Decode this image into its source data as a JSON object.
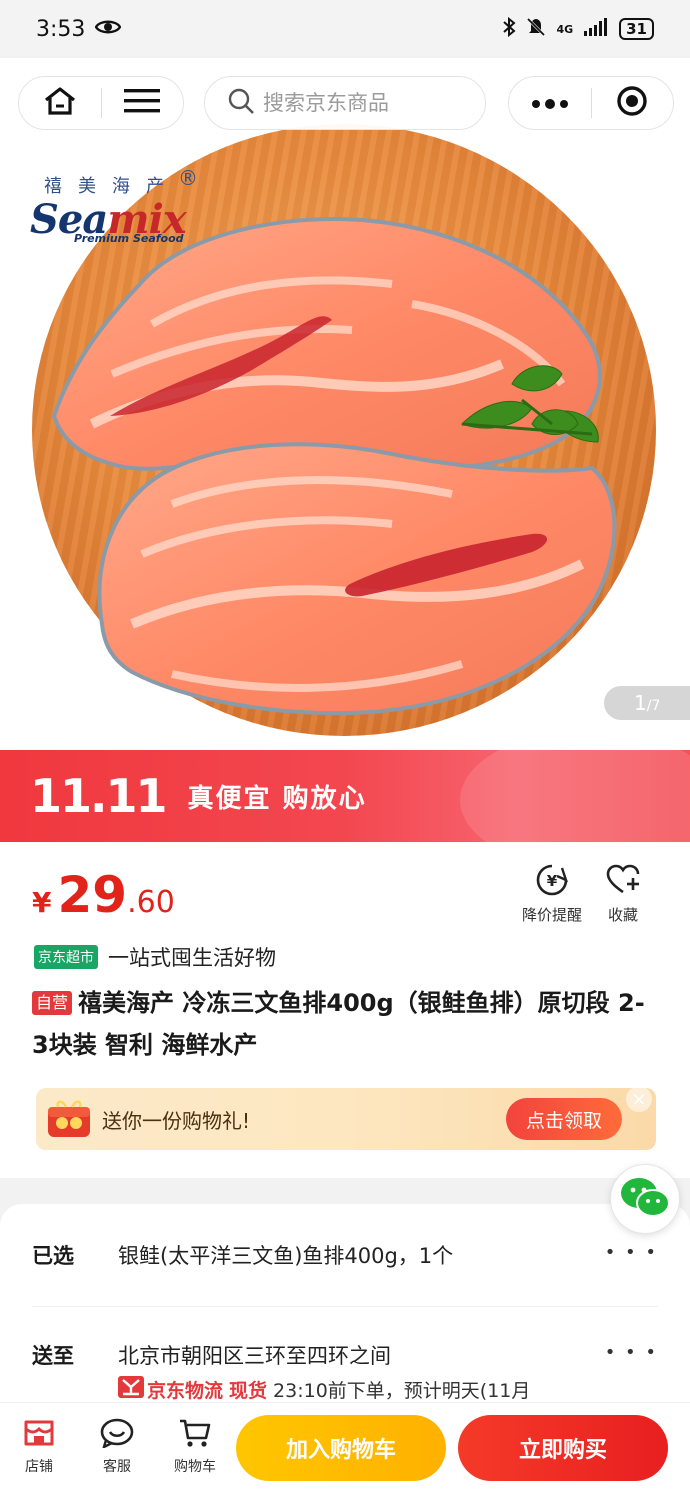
{
  "status_bar": {
    "time": "3:53",
    "network": "4G",
    "battery": "31",
    "icons": [
      "eye-icon",
      "bluetooth-icon",
      "mute-icon",
      "signal-icon",
      "battery-icon"
    ]
  },
  "nav": {
    "icons": [
      "home-icon",
      "menu-icon",
      "search-icon",
      "more-icon",
      "record-icon"
    ],
    "search_placeholder": "搜索京东商品"
  },
  "brand": {
    "cn": "禧美海产",
    "reg": "®",
    "en_a": "Sea",
    "en_b": "mix",
    "sub": "Premium Seafood"
  },
  "gallery": {
    "current": "1",
    "total": "/7"
  },
  "banner": {
    "logo": "11.11",
    "slogan": "真便宜 购放心"
  },
  "product": {
    "currency": "¥",
    "price_int": "29",
    "price_dec": ".60",
    "actions": [
      {
        "label": "降价提醒",
        "icon": "price-alert-icon"
      },
      {
        "label": "收藏",
        "icon": "favorite-icon"
      }
    ],
    "store_badge": "京东超市",
    "store_slogan": "一站式囤生活好物",
    "self_badge": "自营",
    "title": "禧美海产 冷冻三文鱼排400g（银鲑鱼排）原切段 2-3块装 智利 海鲜水产"
  },
  "gift": {
    "text": "送你一份购物礼!",
    "button": "点击领取",
    "close": "×"
  },
  "spec": {
    "selected_label": "已选",
    "selected_value": "银鲑(太平洋三文鱼)鱼排400g，1个",
    "ship_label": "送至",
    "ship_value": "北京市朝阳区三环至四环之间",
    "logistics_brand": "京东物流",
    "stock": "现货",
    "delivery": "23:10前下单，预计明天(11月"
  },
  "bottom": {
    "tabs": [
      {
        "label": "店铺",
        "icon": "store-icon"
      },
      {
        "label": "客服",
        "icon": "customer-service-icon"
      },
      {
        "label": "购物车",
        "icon": "cart-icon"
      }
    ],
    "add_cart": "加入购物车",
    "buy_now": "立即购买"
  },
  "colors": {
    "jd_red": "#e2231a",
    "cart_yellow": "#ffc600",
    "banner_red": "#f0383e",
    "chip_green": "#19a665"
  }
}
